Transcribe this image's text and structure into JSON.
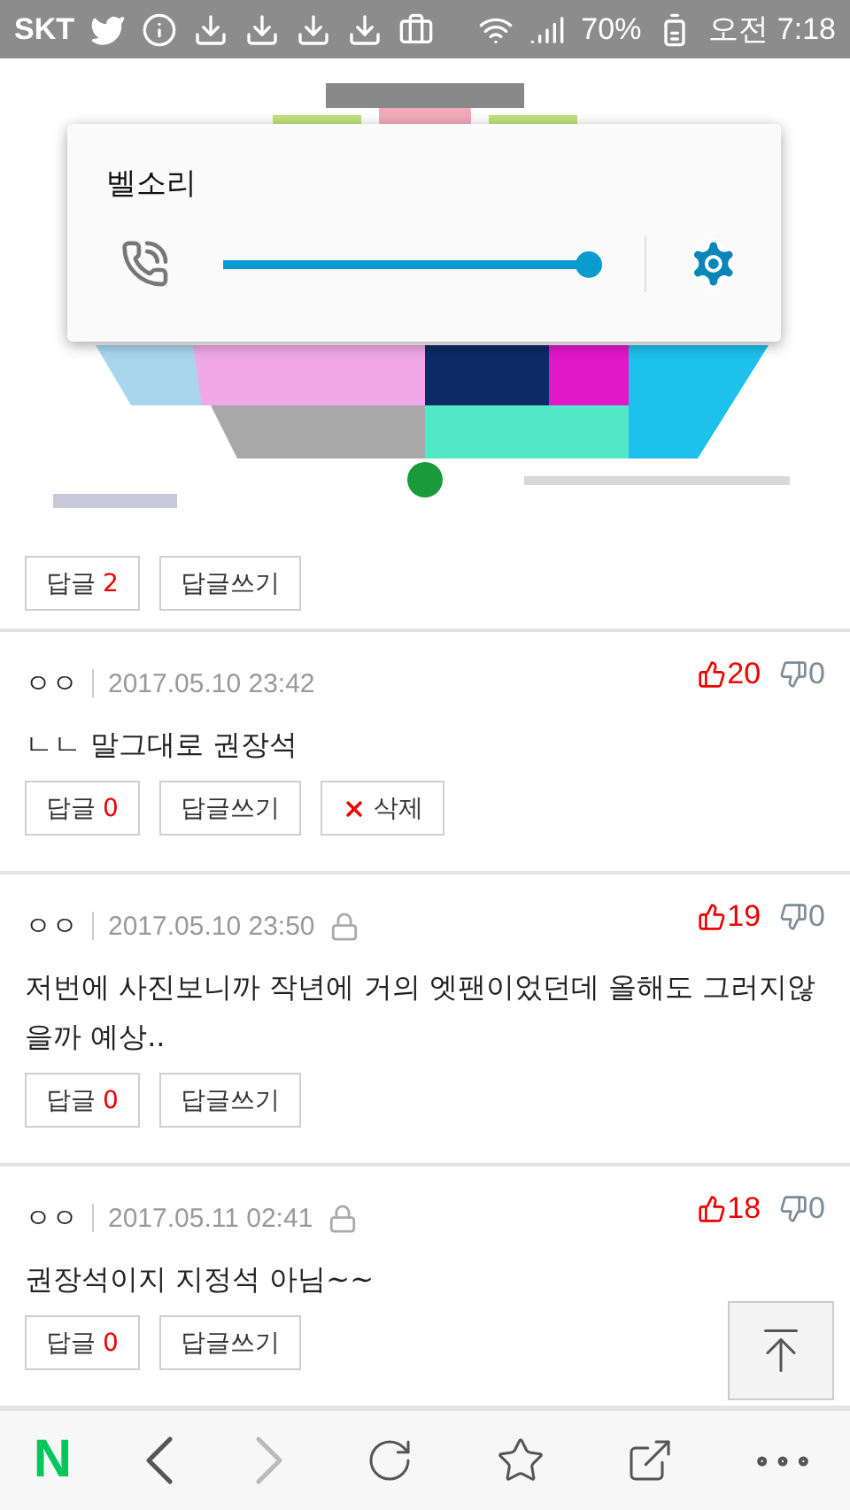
{
  "status_bar": {
    "carrier": "SKT",
    "battery": "70%",
    "time": "오전 7:18"
  },
  "volume_dialog": {
    "title": "벨소리",
    "level": 1
  },
  "top_post": {
    "reply_label": "답글",
    "reply_count": "2",
    "write_label": "답글쓰기"
  },
  "comments": [
    {
      "author": "ㅇㅇ",
      "date": "2017.05.10 23:42",
      "locked": false,
      "likes": "20",
      "dislikes": "0",
      "text": "ㄴㄴ 말그대로 권장석",
      "reply_label": "답글",
      "reply_count": "0",
      "write_label": "답글쓰기",
      "delete_label": "삭제"
    },
    {
      "author": "ㅇㅇ",
      "date": "2017.05.10 23:50",
      "locked": true,
      "likes": "19",
      "dislikes": "0",
      "text": "저번에 사진보니까 작년에 거의 엣팬이었던데 올해도 그러지않을까 예상..",
      "reply_label": "답글",
      "reply_count": "0",
      "write_label": "답글쓰기"
    },
    {
      "author": "ㅇㅇ",
      "date": "2017.05.11 02:41",
      "locked": true,
      "likes": "18",
      "dislikes": "0",
      "text": "권장석이지 지정석 아님~~",
      "reply_label": "답글",
      "reply_count": "0",
      "write_label": "답글쓰기"
    }
  ],
  "nav": {
    "logo": "N",
    "items": [
      {
        "kind": "back",
        "disabled": false
      },
      {
        "kind": "forward",
        "disabled": true
      },
      {
        "kind": "reload",
        "disabled": false
      },
      {
        "kind": "bookmark",
        "disabled": false
      },
      {
        "kind": "share",
        "disabled": false
      },
      {
        "kind": "more",
        "disabled": false
      }
    ]
  }
}
